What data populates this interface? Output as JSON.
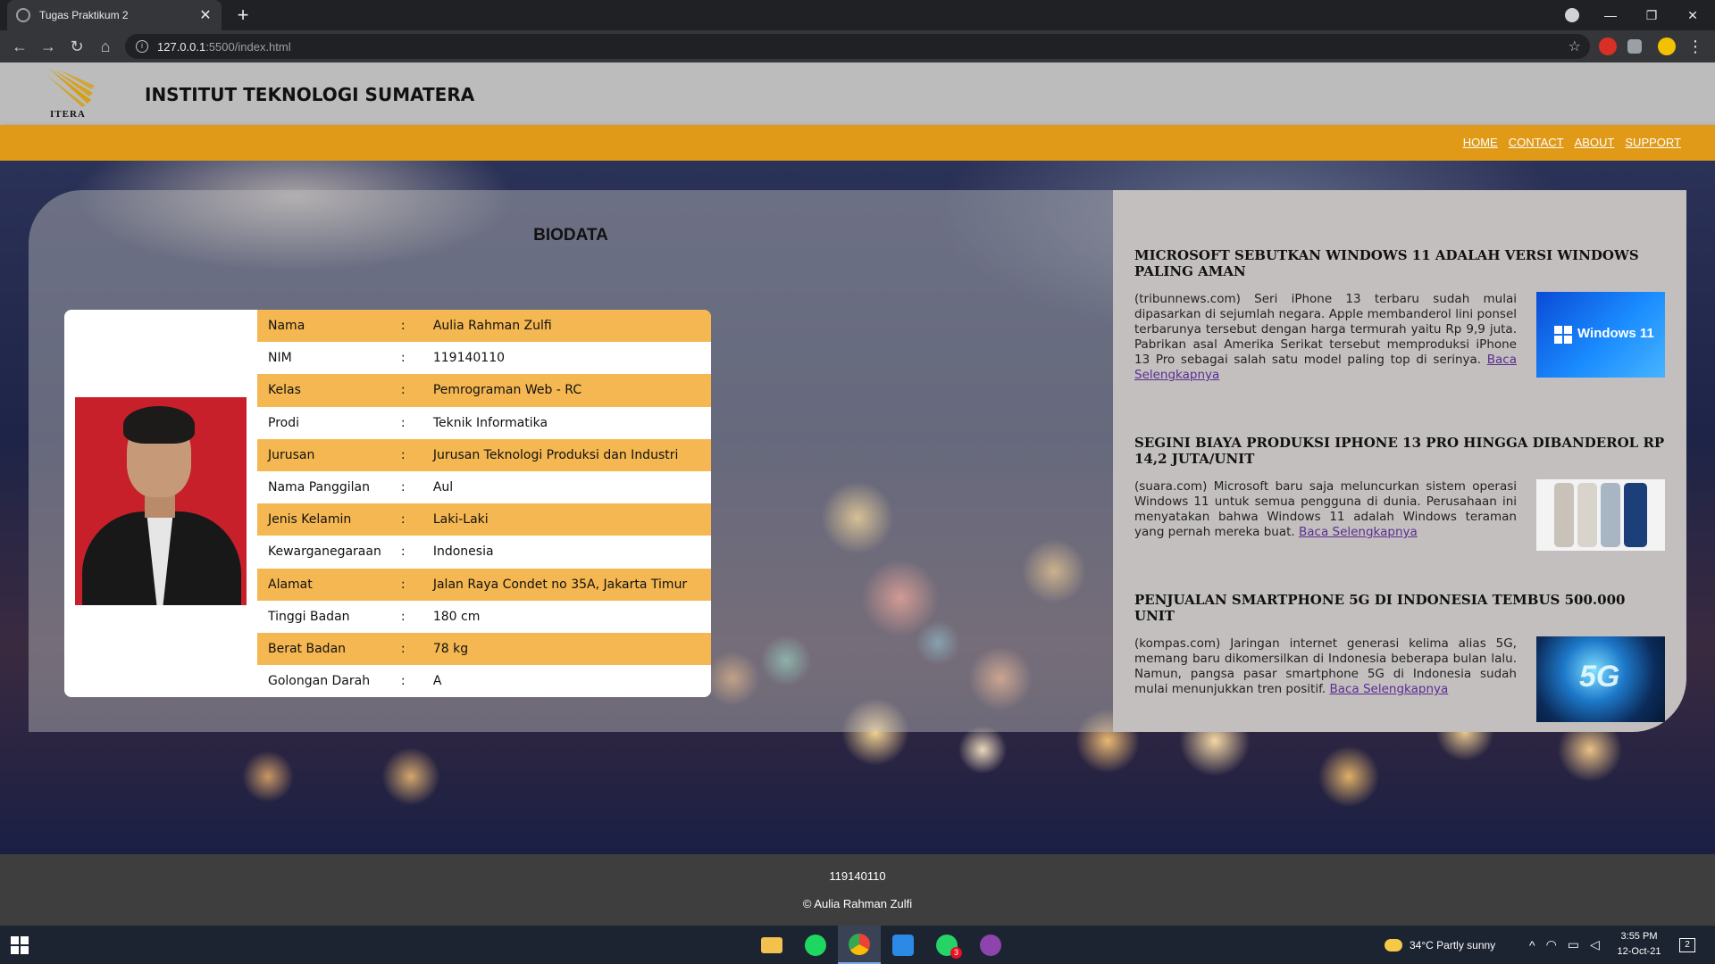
{
  "browser": {
    "tab_title": "Tugas Praktikum 2",
    "tab_close": "✕",
    "new_tab": "+",
    "url_host": "127.0.0.1",
    "url_path": ":5500/index.html",
    "back": "←",
    "forward": "→",
    "reload": "↻",
    "home": "⌂",
    "star": "☆",
    "minimize": "—",
    "restore": "❐",
    "close": "✕",
    "menu": "⋮"
  },
  "header": {
    "logo_text": "ITERA",
    "site_title": "INSTITUT TEKNOLOGI SUMATERA"
  },
  "nav": {
    "items": [
      "HOME",
      "CONTACT",
      "ABOUT",
      "SUPPORT"
    ]
  },
  "biodata": {
    "title": "BIODATA",
    "rows": [
      {
        "label": "Nama",
        "sep": ":",
        "value": "Aulia Rahman Zulfi"
      },
      {
        "label": "NIM",
        "sep": ":",
        "value": "119140110"
      },
      {
        "label": "Kelas",
        "sep": ":",
        "value": "Pemrograman Web - RC"
      },
      {
        "label": "Prodi",
        "sep": ":",
        "value": "Teknik Informatika"
      },
      {
        "label": "Jurusan",
        "sep": ":",
        "value": "Jurusan Teknologi Produksi dan Industri"
      },
      {
        "label": "Nama Panggilan",
        "sep": ":",
        "value": "Aul"
      },
      {
        "label": "Jenis Kelamin",
        "sep": ":",
        "value": "Laki-Laki"
      },
      {
        "label": "Kewarganegaraan",
        "sep": ":",
        "value": "Indonesia"
      },
      {
        "label": "Alamat",
        "sep": ":",
        "value": "Jalan Raya Condet no 35A, Jakarta Timur"
      },
      {
        "label": "Tinggi Badan",
        "sep": ":",
        "value": "180 cm"
      },
      {
        "label": "Berat Badan",
        "sep": ":",
        "value": "78 kg"
      },
      {
        "label": "Golongan Darah",
        "sep": ":",
        "value": "A"
      }
    ]
  },
  "news": [
    {
      "title": "MICROSOFT SEBUTKAN WINDOWS 11 ADALAH VERSI WINDOWS PALING AMAN",
      "text": "(tribunnews.com) Seri iPhone 13 terbaru sudah mulai dipasarkan di sejumlah negara. Apple membanderol lini ponsel terbarunya tersebut dengan harga termurah yaitu Rp 9,9 juta. Pabrikan asal Amerika Serikat tersebut memproduksi iPhone 13 Pro sebagai salah satu model paling top di serinya.",
      "link": "Baca Selengkapnya",
      "image_text": "Windows 11"
    },
    {
      "title": "SEGINI BIAYA PRODUKSI IPHONE 13 PRO HINGGA DIBANDEROL RP 14,2 JUTA/UNIT",
      "text": "(suara.com) Microsoft baru saja meluncurkan sistem operasi Windows 11 untuk semua pengguna di dunia. Perusahaan ini menyatakan bahwa Windows 11 adalah Windows teraman yang pernah mereka buat.",
      "link": "Baca Selengkapnya"
    },
    {
      "title": "PENJUALAN SMARTPHONE 5G DI INDONESIA TEMBUS 500.000 UNIT",
      "text": "(kompas.com) Jaringan internet generasi kelima alias 5G, memang baru dikomersilkan di Indonesia beberapa bulan lalu. Namun, pangsa pasar smartphone 5G di Indonesia sudah mulai menunjukkan tren positif.",
      "link": "Baca Selengkapnya",
      "image_text": "5G"
    }
  ],
  "footer": {
    "line1": "119140110",
    "line2": "© Aulia Rahman Zulfi"
  },
  "taskbar": {
    "weather": "34°C  Partly sunny",
    "time": "3:55 PM",
    "date": "12-Oct-21",
    "whatsapp_badge": "3",
    "notif_badge": "2"
  },
  "colors": {
    "navbar": "#e09a17",
    "header": "#bcbcbc",
    "row_highlight": "#f4b751",
    "footer": "#3e3e3e"
  }
}
